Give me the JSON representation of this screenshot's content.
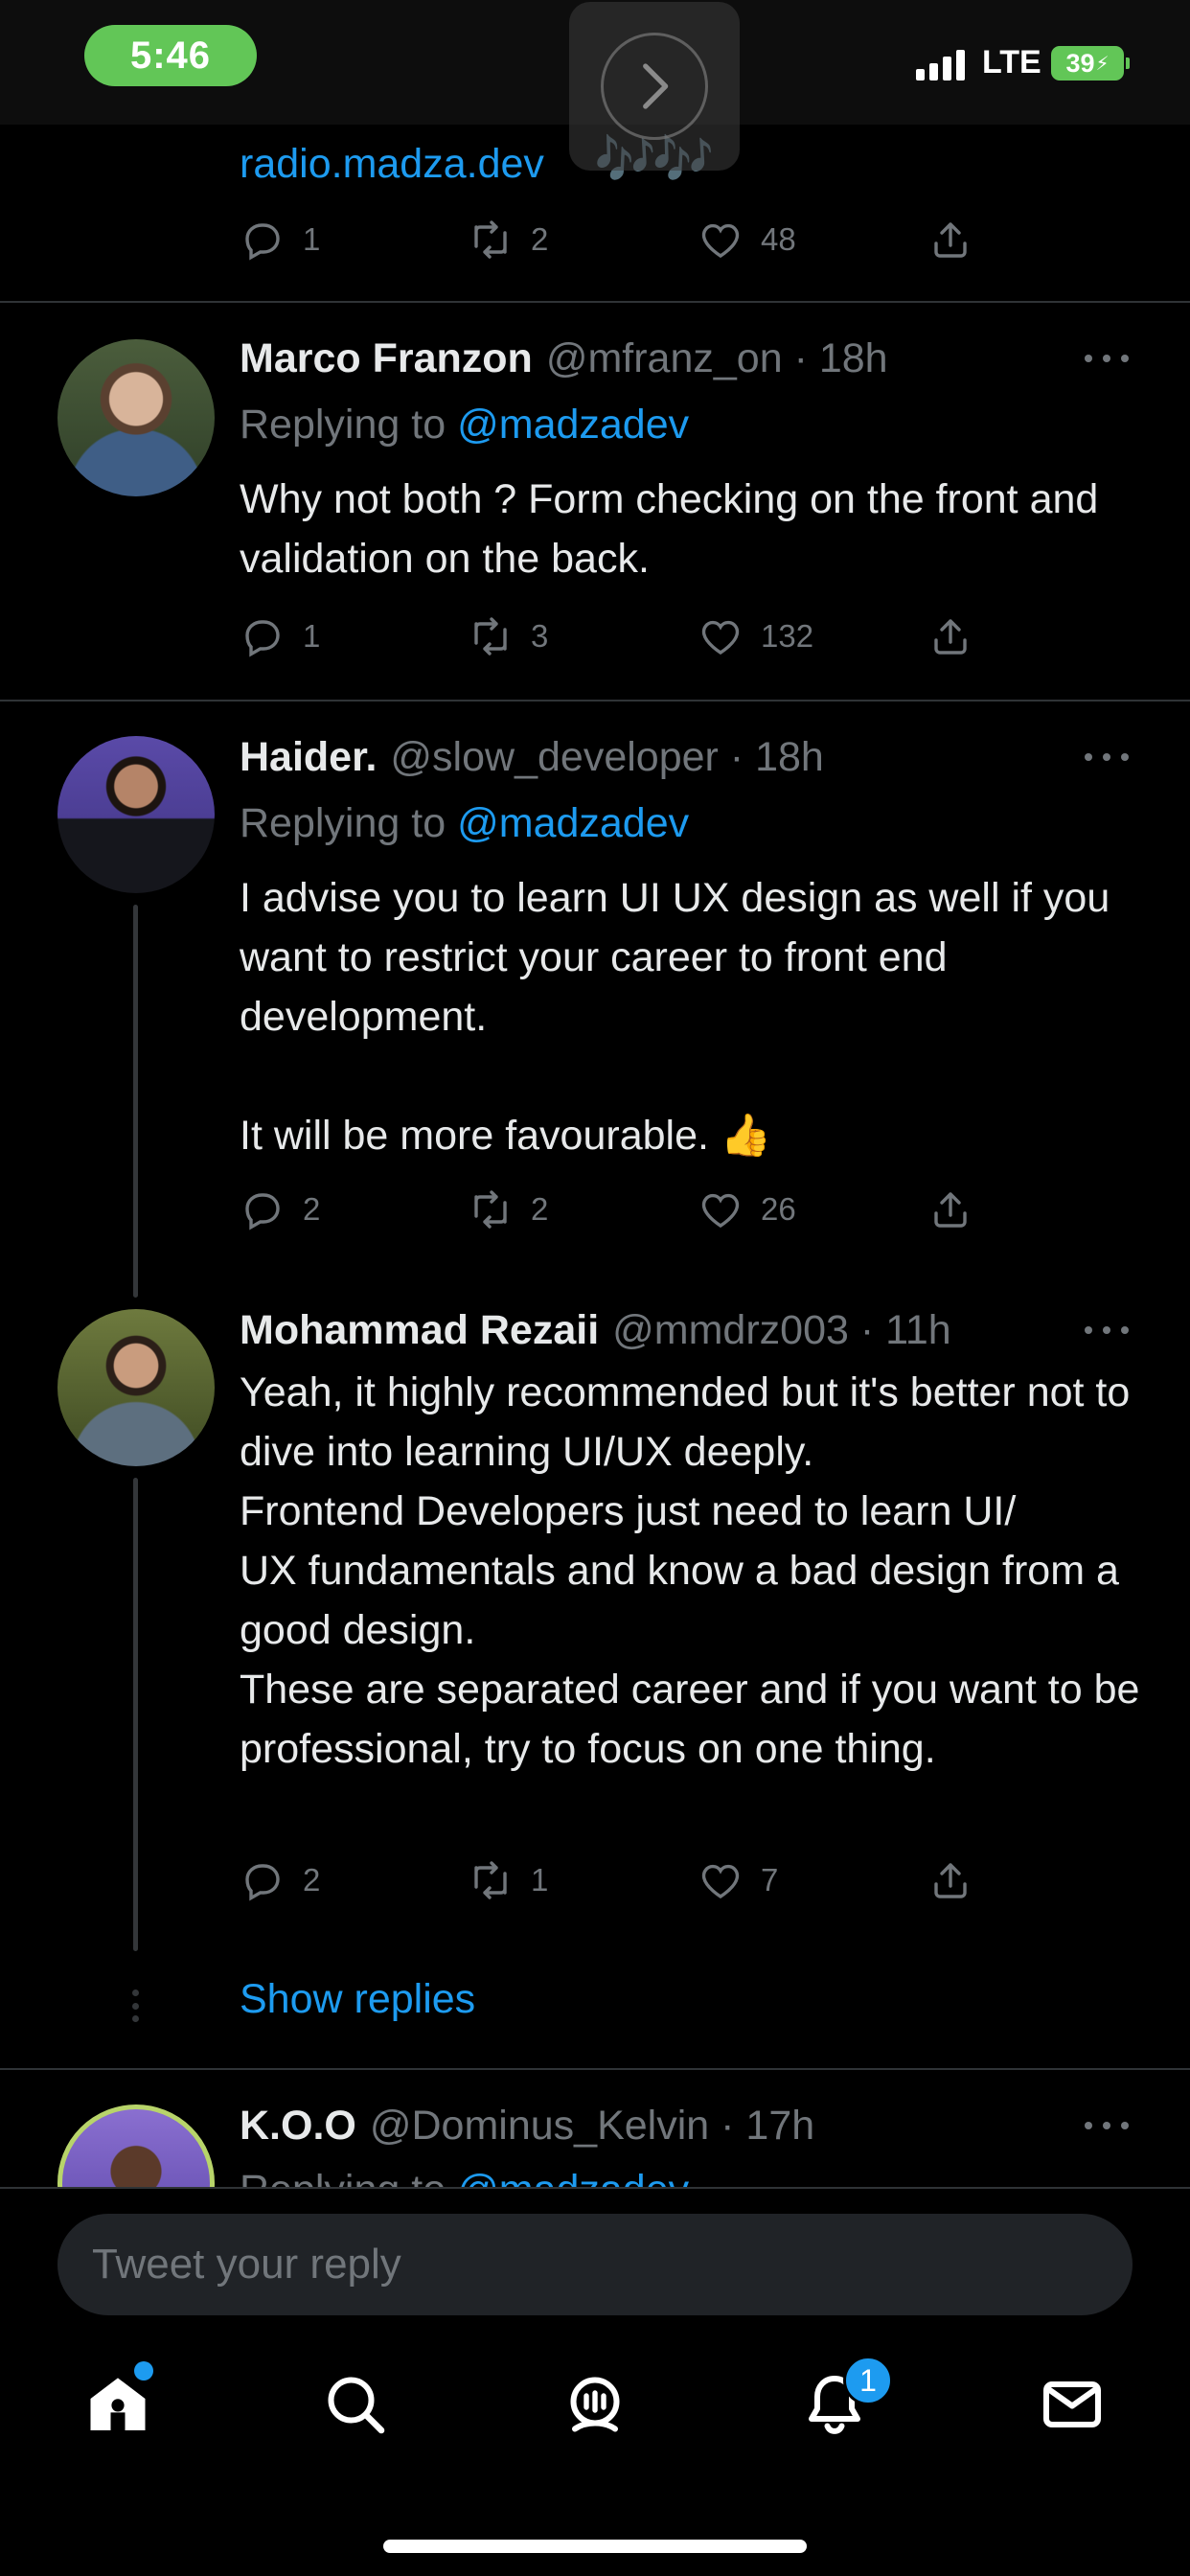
{
  "status_bar": {
    "time": "5:46",
    "network": "LTE",
    "battery": "39"
  },
  "top_tweet": {
    "link_text": "radio.madza.dev",
    "emoji": "🎶🎶",
    "replies": "1",
    "retweets": "2",
    "likes": "48"
  },
  "tweets": [
    {
      "name": "Marco Franzon",
      "handle": "@mfranz_on · 18h",
      "replying_prefix": "Replying to",
      "replying_to": "@madzadev",
      "text": "Why not both ? Form checking on the front and validation on the back.",
      "replies": "1",
      "retweets": "3",
      "likes": "132"
    },
    {
      "name": "Haider.",
      "handle": "@slow_developer · 18h",
      "replying_prefix": "Replying to",
      "replying_to": "@madzadev",
      "text": "I advise you to learn UI UX design as well if you want to restrict your career to front end development.\n\nIt will be more favourable. 👍",
      "replies": "2",
      "retweets": "2",
      "likes": "26"
    },
    {
      "name": "Mohammad Rezaii",
      "handle": "@mmdrz003 · 11h",
      "text": "Yeah, it highly recommended but it's better not to dive into learning UI/UX deeply.\nFrontend Developers just need to learn UI/\nUX fundamentals and know a bad design from a good design.\nThese are separated career and if you want to be professional, try to focus on one thing.",
      "replies": "2",
      "retweets": "1",
      "likes": "7"
    },
    {
      "name": "K.O.O",
      "handle": "@Dominus_Kelvin · 17h",
      "replying_prefix": "Replying to",
      "replying_to": "@madzadev"
    }
  ],
  "show_replies": "Show replies",
  "reply_bar": {
    "placeholder": "Tweet your reply"
  },
  "tab_bar": {
    "items": [
      "home-icon",
      "search-icon",
      "spaces-icon",
      "notifications-icon",
      "messages-icon"
    ],
    "notification_count": "1"
  },
  "colors": {
    "accent": "#1d9bf0",
    "muted": "#71767b",
    "background": "#000000",
    "status_green": "#62c657"
  }
}
